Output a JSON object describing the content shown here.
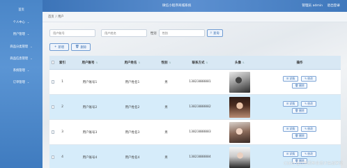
{
  "sidebar": {
    "items": [
      {
        "label": "首页",
        "chevron": ""
      },
      {
        "label": "个人中心",
        "chevron": "⌄"
      },
      {
        "label": "用户管理",
        "chevron": "⌄"
      },
      {
        "label": "商品分类管理",
        "chevron": "⌄"
      },
      {
        "label": "商品信息管理",
        "chevron": "⌄"
      },
      {
        "label": "系统管理",
        "chevron": "⌄"
      },
      {
        "label": "订单管理",
        "chevron": "⌄"
      }
    ]
  },
  "header": {
    "title": "微信小程序商城系统",
    "user": "管理员 admin",
    "logout": "退出登录"
  },
  "breadcrumb": {
    "home": "首页",
    "sep": "/",
    "current": "用户"
  },
  "search": {
    "account_placeholder": "用户账号",
    "name_placeholder": "用户姓名",
    "sex_label": "性别",
    "sex_placeholder": "性别",
    "button": "查询"
  },
  "ops": {
    "add": "新增",
    "delete": "删除"
  },
  "table": {
    "columns": [
      "索引",
      "用户账号",
      "用户姓名",
      "性别",
      "联系方式",
      "头像",
      "操作"
    ],
    "rows": [
      {
        "index": "1",
        "account": "用户账号1",
        "name": "用户姓名1",
        "sex": "男",
        "phone": "13823888881"
      },
      {
        "index": "2",
        "account": "用户账号2",
        "name": "用户姓名2",
        "sex": "男",
        "phone": "13823888882"
      },
      {
        "index": "3",
        "account": "用户账号3",
        "name": "用户姓名3",
        "sex": "男",
        "phone": "13823888883"
      },
      {
        "index": "4",
        "account": "用户账号4",
        "name": "用户姓名4",
        "sex": "男",
        "phone": "13823888884"
      }
    ],
    "row_actions": {
      "detail": "详情",
      "edit": "修改",
      "delete": "删除"
    }
  },
  "watermark": "CSDN @计算机毕业设计实战学堂",
  "colors": {
    "accent": "#3c74b8",
    "row_even": "#d6ecfa",
    "header_row": "#d8e8f4"
  }
}
